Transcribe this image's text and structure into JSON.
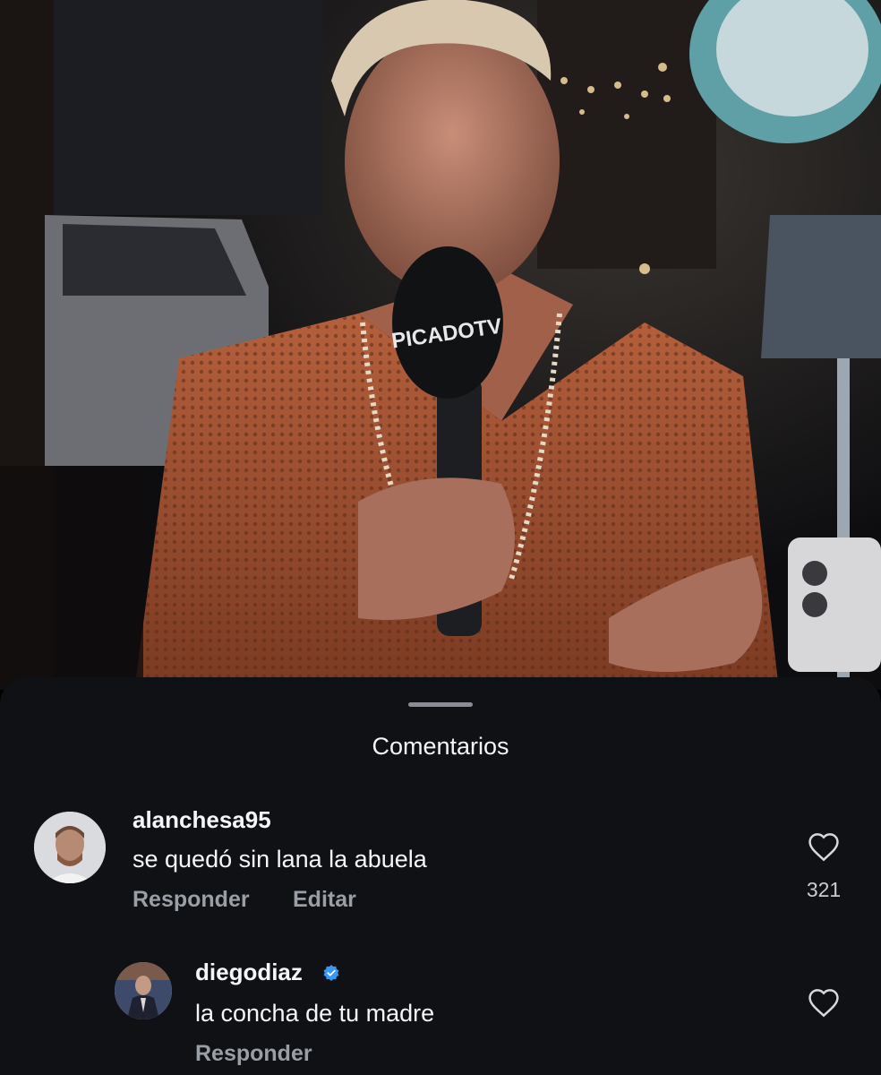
{
  "video": {
    "microphone_brand": "PICADOTV"
  },
  "comments_sheet": {
    "title": "Comentarios",
    "comments": [
      {
        "username": "alanchesa95",
        "text": "se quedó sin lana la abuela",
        "actions": [
          "Responder",
          "Editar"
        ],
        "likes": "321",
        "verified": false
      },
      {
        "username": "diegodiaz",
        "text": "la concha de tu madre",
        "actions": [
          "Responder"
        ],
        "likes": "",
        "verified": true,
        "is_reply": true
      }
    ]
  },
  "colors": {
    "sheet_background": "#0f1114",
    "primary_text": "#f3f5f7",
    "secondary_text": "#9a9ea5",
    "verified_badge": "#3897f0"
  },
  "icons": [
    "heart-icon",
    "verified-badge-icon"
  ]
}
